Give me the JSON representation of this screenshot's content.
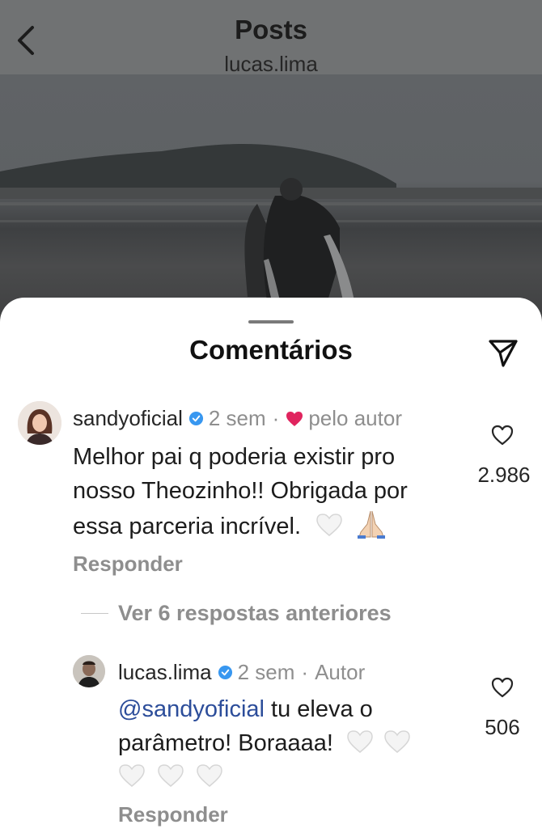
{
  "header": {
    "title": "Posts",
    "subtitle": "lucas.lima"
  },
  "sheet": {
    "title": "Comentários"
  },
  "comments": [
    {
      "username": "sandyoficial",
      "time": "2 sem",
      "separator": "·",
      "liked_by_author": "pelo autor",
      "text": "Melhor pai q poderia existir pro nosso Theozinho!! Obrigada por essa parceria incrível.",
      "text_line1": "Melhor pai q poderia existir pro",
      "text_line2": "nosso Theozinho!! Obrigada por",
      "text_line3": "essa parceria incrível.",
      "likes": "2.986",
      "reply_label": "Responder"
    },
    {
      "username": "lucas.lima",
      "time": "2 sem",
      "separator": "·",
      "author_badge": "Autor",
      "mention": "@sandyoficial",
      "text_line1_rest": " tu eleva o",
      "text_line2": "parâmetro! Boraaaa!",
      "likes": "506",
      "reply_label": "Responder"
    }
  ],
  "view_replies": "Ver 6 respostas anteriores",
  "icons": {
    "back": "chevron-left-icon",
    "share": "paper-plane-icon",
    "verified": "verified-badge-icon",
    "heart": "heart-outline-icon",
    "author_heart": "red-heart-icon",
    "white_heart": "white-heart-emoji",
    "pray": "folded-hands-emoji"
  },
  "colors": {
    "verified": "#3897f0",
    "author_heart": "#e0245e",
    "mention": "#2c4d9a",
    "secondary_text": "#8e8e8e"
  }
}
